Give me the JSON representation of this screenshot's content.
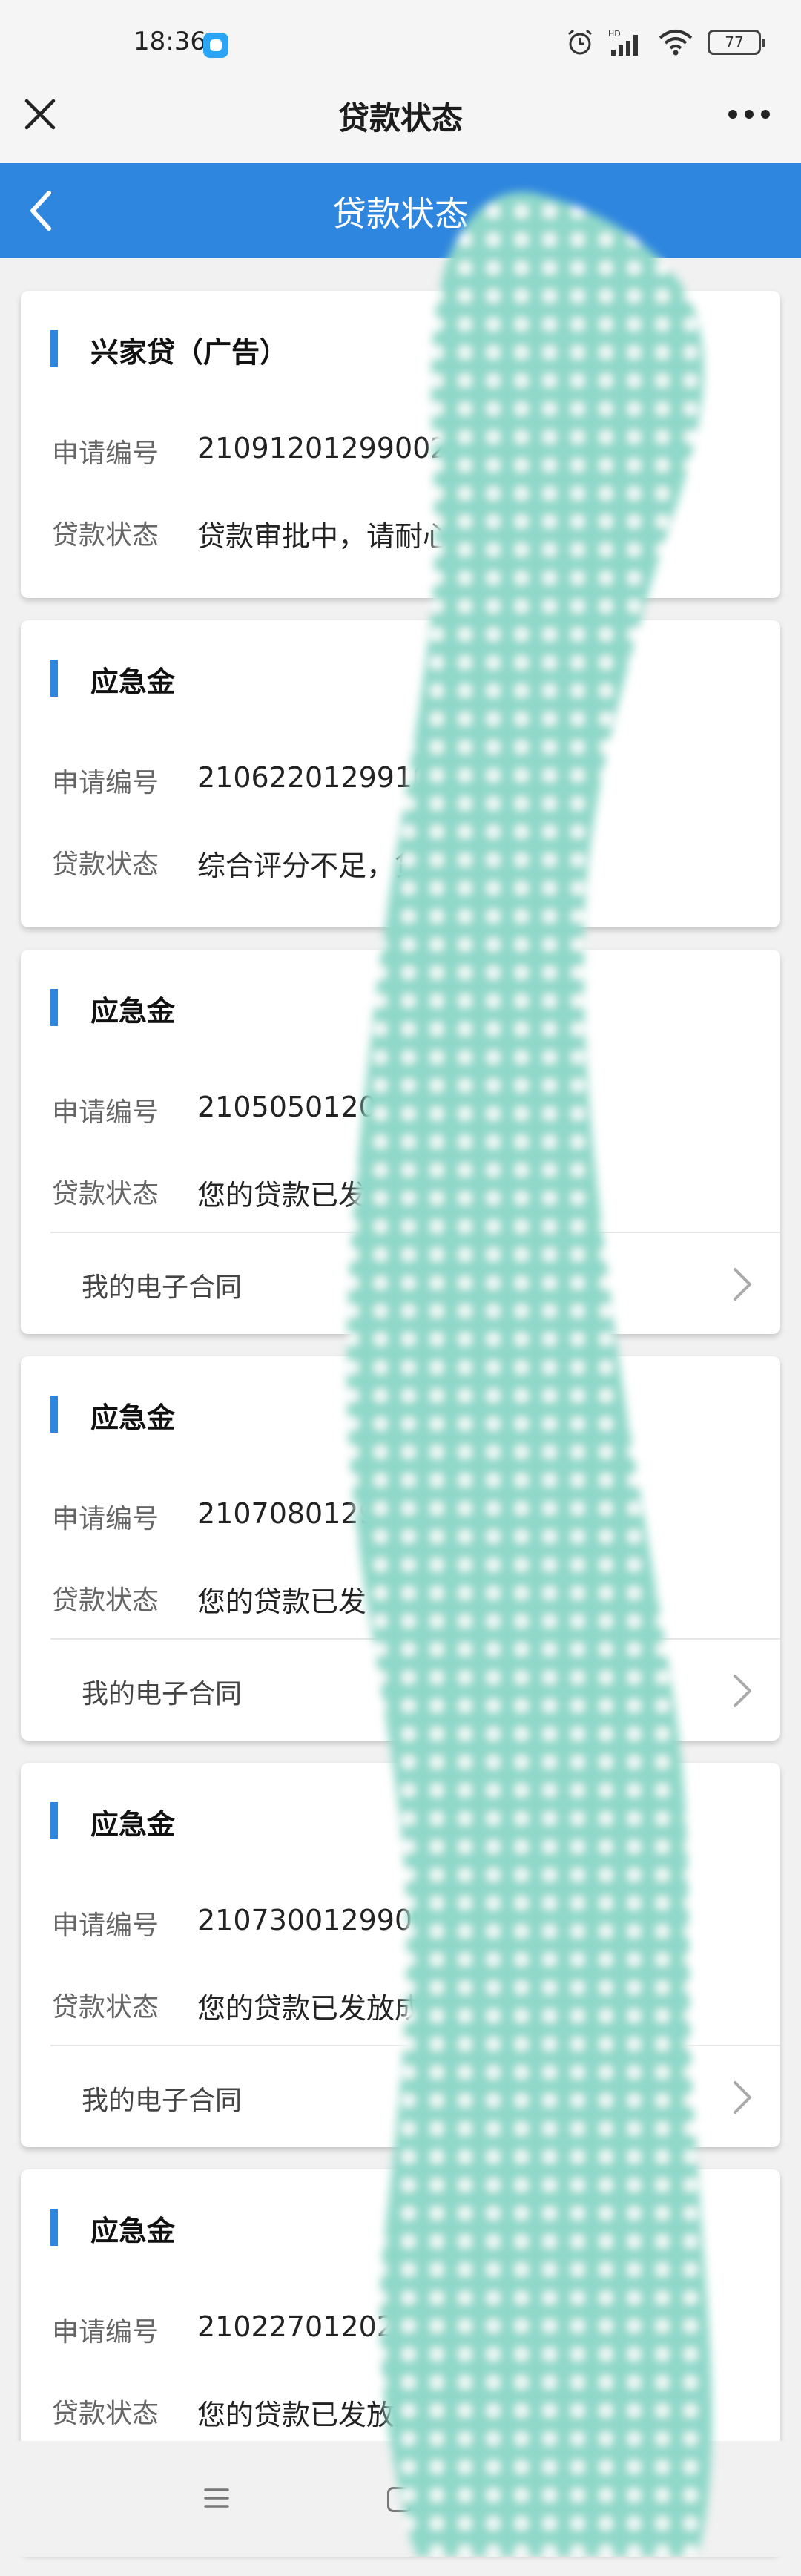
{
  "status_bar": {
    "time": "18:36",
    "battery": "77",
    "icons": [
      "app-notification-icon",
      "alarm-icon",
      "hd-signal-icon",
      "wifi-icon",
      "battery-icon"
    ]
  },
  "webview_header": {
    "title": "贷款状态",
    "close_icon": "close-icon",
    "more_icon": "more-icon"
  },
  "app_header": {
    "title": "贷款状态",
    "back_icon": "chevron-left-icon"
  },
  "labels": {
    "application_no": "申请编号",
    "loan_status": "贷款状态",
    "contract": "我的电子合同"
  },
  "cards": [
    {
      "product": "兴家贷（广告）",
      "application_no": "21091201299002010",
      "status": "贷款审批中，请耐心等",
      "has_contract": false
    },
    {
      "product": "应急金",
      "application_no": "2106220129910010",
      "status": "综合评分不足，贷",
      "has_contract": false
    },
    {
      "product": "应急金",
      "application_no": "210505012021001",
      "status": "您的贷款已发放",
      "has_contract": true
    },
    {
      "product": "应急金",
      "application_no": "2107080129                    WZK",
      "status": "您的贷款已发",
      "has_contract": true
    },
    {
      "product": "应急金",
      "application_no": "21073001299005",
      "status": "您的贷款已发放成功",
      "has_contract": true
    },
    {
      "product": "应急金",
      "application_no": "210227012021001",
      "status": "您的贷款已发放成功",
      "has_contract": true
    }
  ],
  "nav_bar": {
    "icons": [
      "menu-icon",
      "home-icon",
      "back-icon"
    ]
  },
  "colors": {
    "accent": "#2e86de",
    "censor_fill": "#8fd8c9",
    "censor_dot": "#ffffff"
  }
}
